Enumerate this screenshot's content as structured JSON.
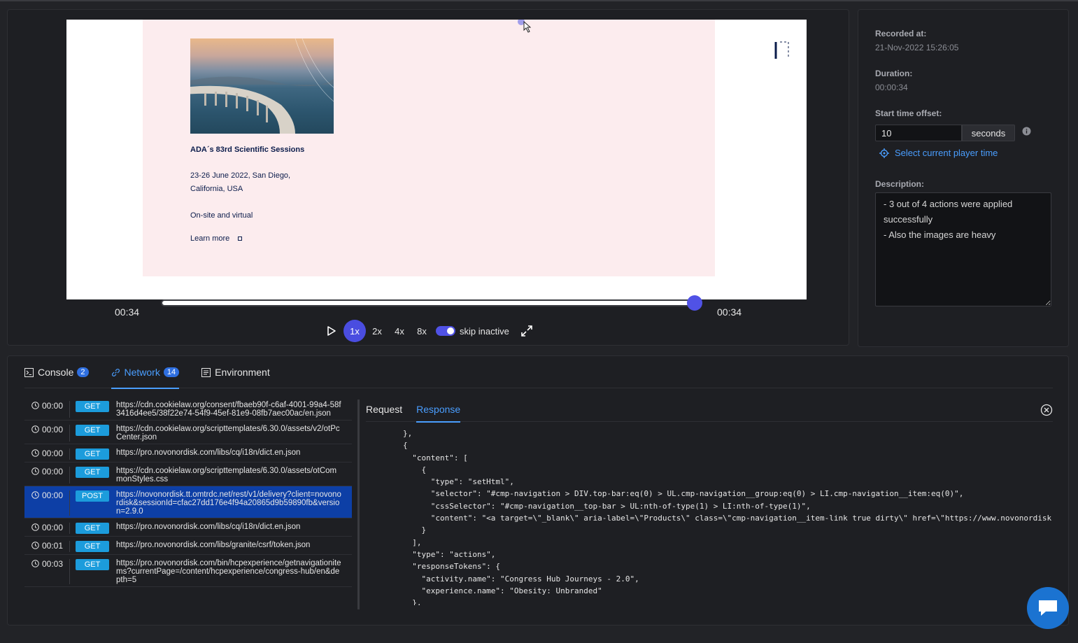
{
  "player": {
    "event": {
      "title": "ADA´s 83rd Scientific Sessions",
      "date_line1": "23-26 June 2022, San Diego,",
      "date_line2": "California, USA",
      "format": "On-site and virtual",
      "learn_more": "Learn more"
    },
    "current_time": "00:34",
    "total_time": "00:34",
    "progress_fraction": 1.0,
    "speeds": [
      "1x",
      "2x",
      "4x",
      "8x"
    ],
    "active_speed": "1x",
    "skip_inactive_label": "skip inactive",
    "skip_inactive_on": true
  },
  "side": {
    "recorded_label": "Recorded at:",
    "recorded_value": "21-Nov-2022 15:26:05",
    "duration_label": "Duration:",
    "duration_value": "00:00:34",
    "offset_label": "Start time offset:",
    "offset_value": "10",
    "offset_unit": "seconds",
    "select_time_label": "Select current player time",
    "description_label": "Description:",
    "description_value": "- 3 out of 4 actions were applied successfully\n- Also the images are heavy"
  },
  "tabs": [
    {
      "label": "Console",
      "badge": "2"
    },
    {
      "label": "Network",
      "badge": "14"
    },
    {
      "label": "Environment",
      "badge": ""
    }
  ],
  "network": [
    {
      "time": "00:00",
      "method": "GET",
      "url": "https://cdn.cookielaw.org/consent/fbaeb90f-c6af-4001-99a4-58f3416d4ee5/38f22e74-54f9-45ef-81e9-08fb7aec00ac/en.json"
    },
    {
      "time": "00:00",
      "method": "GET",
      "url": "https://cdn.cookielaw.org/scripttemplates/6.30.0/assets/v2/otPcCenter.json"
    },
    {
      "time": "00:00",
      "method": "GET",
      "url": "https://pro.novonordisk.com/libs/cq/i18n/dict.en.json"
    },
    {
      "time": "00:00",
      "method": "GET",
      "url": "https://cdn.cookielaw.org/scripttemplates/6.30.0/assets/otCommonStyles.css"
    },
    {
      "time": "00:00",
      "method": "POST",
      "url": "https://novonordisk.tt.omtrdc.net/rest/v1/delivery?client=novonordisk&sessionId=cfac27dd176e4f94a20865d9b59890fb&version=2.9.0",
      "selected": true
    },
    {
      "time": "00:00",
      "method": "GET",
      "url": "https://pro.novonordisk.com/libs/cq/i18n/dict.en.json"
    },
    {
      "time": "00:01",
      "method": "GET",
      "url": "https://pro.novonordisk.com/libs/granite/csrf/token.json"
    },
    {
      "time": "00:03",
      "method": "GET",
      "url": "https://pro.novonordisk.com/bin/hcpexperience/getnavigationitems?currentPage=/content/hcpexperience/congress-hub/en&depth=5"
    }
  ],
  "detail": {
    "tabs": [
      "Request",
      "Response"
    ],
    "active_tab": "Response",
    "code_lines": [
      "        },",
      "        {",
      "          \"content\": [",
      "            {",
      "              \"type\": \"setHtml\",",
      "              \"selector\": \"#cmp-navigation > DIV.top-bar:eq(0) > UL.cmp-navigation__group:eq(0) > LI.cmp-navigation__item:eq(0)\",",
      "              \"cssSelector\": \"#cmp-navigation__top-bar > UL:nth-of-type(1) > LI:nth-of-type(1)\",",
      "              \"content\": \"<a target=\\\"_blank\\\" aria-label=\\\"Products\\\" class=\\\"cmp-navigation__item-link true dirty\\\" href=\\\"https://www.novonordisk.",
      "            }",
      "          ],",
      "          \"type\": \"actions\",",
      "          \"responseTokens\": {",
      "            \"activity.name\": \"Congress Hub Journeys - 2.0\",",
      "            \"experience.name\": \"Obesity: Unbranded\"",
      "          },"
    ]
  },
  "colors": {
    "accent": "#4a9eff",
    "player_accent": "#5052e6",
    "selected_row": "#0d3fa6",
    "method_badge": "#1c9cdc"
  }
}
